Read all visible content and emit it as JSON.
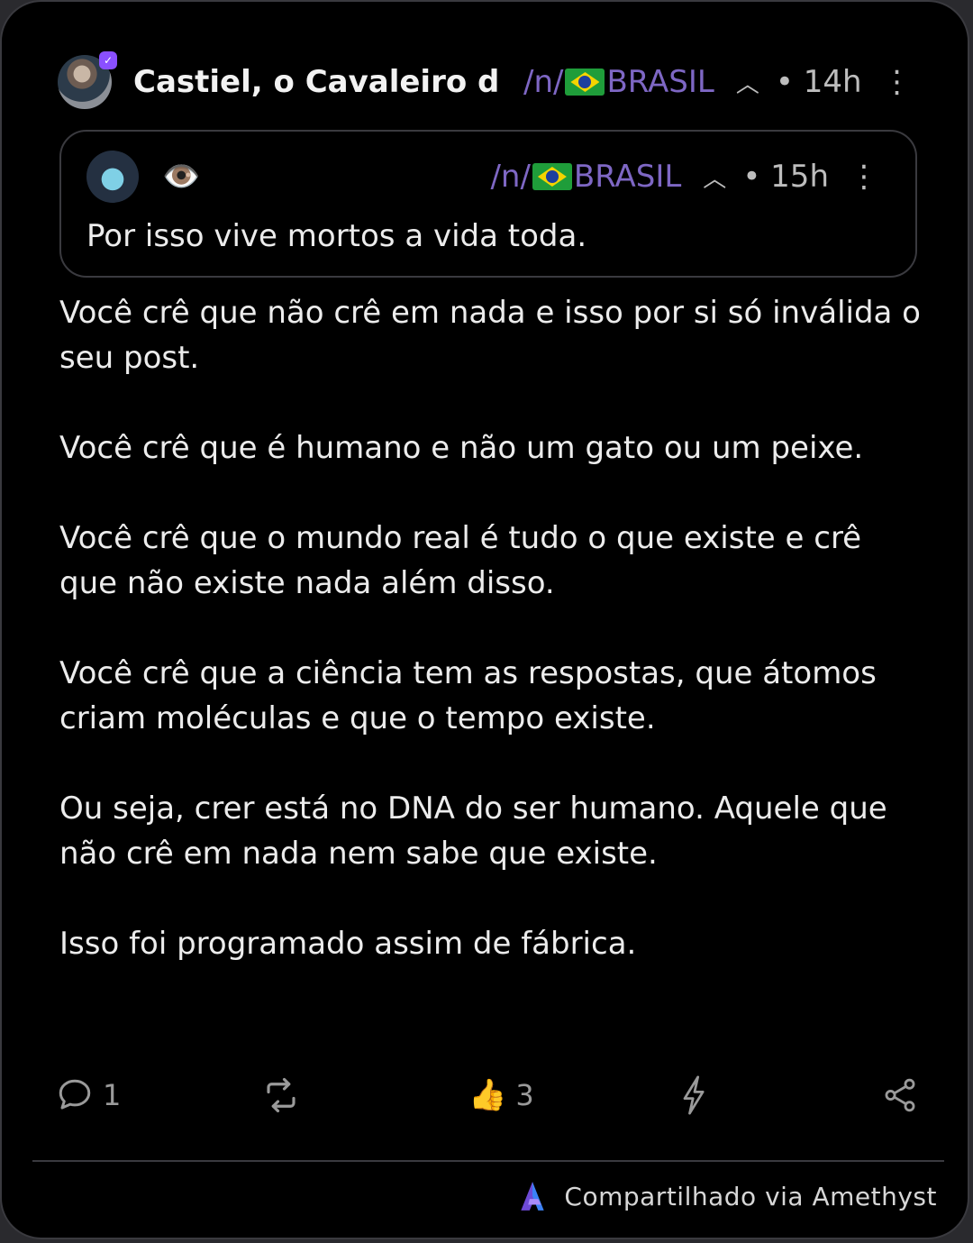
{
  "post": {
    "author": "Castiel, o Cavaleiro da…",
    "community_prefix": "/n/",
    "community_name": "BRASIL",
    "time": "• 14h",
    "more_icon": "⋮"
  },
  "quoted": {
    "author_display": "👁️",
    "community_prefix": "/n/",
    "community_name": "BRASIL",
    "time": "• 15h",
    "more_icon": "⋮",
    "text": "Por isso vive mortos a vida toda."
  },
  "body": {
    "paragraphs": [
      "Você  crê que não crê em nada e isso por si só inválida o seu post.",
      "Você crê que é humano e não um gato ou um peixe.",
      "Você crê que o mundo real é tudo o que existe e crê que não existe nada além disso.",
      "Você crê que a ciência tem as respostas, que átomos criam moléculas e que o tempo existe.",
      "Ou seja, crer está no DNA do ser humano. Aquele que não crê em nada nem sabe que existe.",
      "Isso foi programado assim de fábrica."
    ]
  },
  "actions": {
    "replies": "1",
    "reactions_emoji": "👍",
    "reactions": "3"
  },
  "footer": {
    "text": "Compartilhado via Amethyst"
  },
  "colors": {
    "accent": "#7e67c4",
    "background": "#000000",
    "border": "#3a3a3f"
  }
}
